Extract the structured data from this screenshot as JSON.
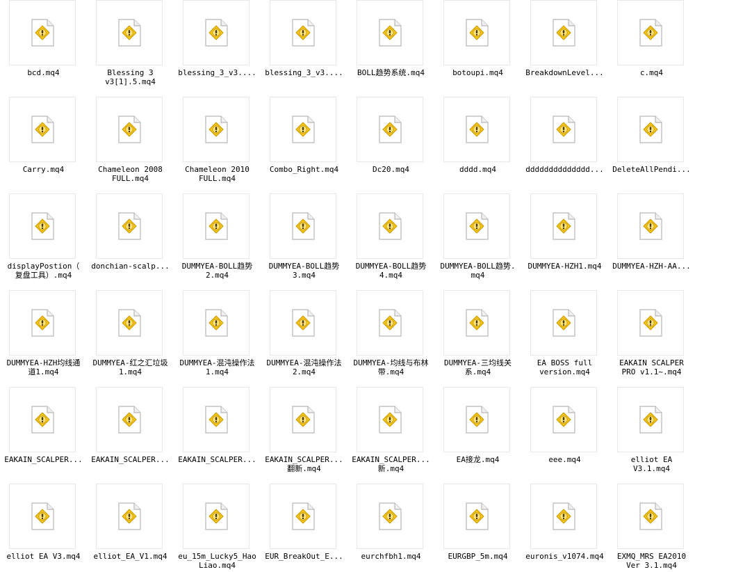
{
  "files": [
    {
      "name": "bcd.mq4"
    },
    {
      "name": "Blessing 3\nv3[1].5.mq4"
    },
    {
      "name": "blessing_3_v3...."
    },
    {
      "name": "blessing_3_v3...."
    },
    {
      "name": "BOLL趋势系统.mq4"
    },
    {
      "name": "botoupi.mq4"
    },
    {
      "name": "BreakdownLevel..."
    },
    {
      "name": "c.mq4"
    },
    {
      "name": "Carry.mq4"
    },
    {
      "name": "Chameleon 2008\nFULL.mq4"
    },
    {
      "name": "Chameleon 2010\nFULL.mq4"
    },
    {
      "name": "Combo_Right.mq4"
    },
    {
      "name": "Dc20.mq4"
    },
    {
      "name": "dddd.mq4"
    },
    {
      "name": "dddddddddddddd..."
    },
    {
      "name": "DeleteAllPendi..."
    },
    {
      "name": "displayPostion（\n复盘工具）.mq4"
    },
    {
      "name": "donchian-scalp..."
    },
    {
      "name": "DUMMYEA-BOLL趋势\n2.mq4"
    },
    {
      "name": "DUMMYEA-BOLL趋势\n3.mq4"
    },
    {
      "name": "DUMMYEA-BOLL趋势\n4.mq4"
    },
    {
      "name": "DUMMYEA-BOLL趋势.\nmq4"
    },
    {
      "name": "DUMMYEA-HZH1.mq4"
    },
    {
      "name": "DUMMYEA-HZH-AA..."
    },
    {
      "name": "DUMMYEA-HZH均线通\n道1.mq4"
    },
    {
      "name": "DUMMYEA-红之汇垃圾\n1.mq4"
    },
    {
      "name": "DUMMYEA-混沌操作法\n1.mq4"
    },
    {
      "name": "DUMMYEA-混沌操作法\n2.mq4"
    },
    {
      "name": "DUMMYEA-均线与布林\n带.mq4"
    },
    {
      "name": "DUMMYEA-三均线关\n系.mq4"
    },
    {
      "name": "EA BOSS full\nversion.mq4"
    },
    {
      "name": "EAKAIN SCALPER\nPRO v1.1~.mq4"
    },
    {
      "name": "EAKAIN_SCALPER..."
    },
    {
      "name": "EAKAIN_SCALPER..."
    },
    {
      "name": "EAKAIN_SCALPER..."
    },
    {
      "name": "EAKAIN_SCALPER...\n翻新.mq4"
    },
    {
      "name": "EAKAIN_SCALPER...\n新.mq4"
    },
    {
      "name": "EA接龙.mq4"
    },
    {
      "name": "eee.mq4"
    },
    {
      "name": "elliot EA\nV3.1.mq4"
    },
    {
      "name": "elliot EA V3.mq4"
    },
    {
      "name": "elliot_EA_V1.mq4"
    },
    {
      "name": "eu_15m_Lucky5_Hao\nLiao.mq4"
    },
    {
      "name": "EUR_BreakOut_E..."
    },
    {
      "name": "eurchfbh1.mq4"
    },
    {
      "name": "EURGBP_5m.mq4"
    },
    {
      "name": "euronis_v1074.mq4"
    },
    {
      "name": "EXMQ_MRS EA2010\nVer 3.1.mq4"
    }
  ],
  "icon": "unknown-file-warning-icon",
  "colors": {
    "warning_fill": "#f7c51c",
    "warning_border": "#c99a00",
    "warning_mark": "#4a3a00",
    "doc_border": "#b7b7b7"
  }
}
